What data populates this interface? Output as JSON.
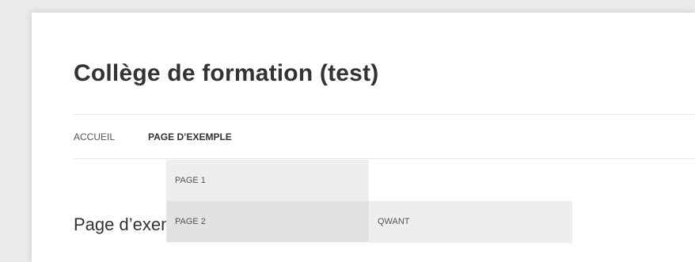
{
  "site": {
    "title": "Collège de formation (test)"
  },
  "nav": {
    "items": [
      {
        "label": "ACCUEIL"
      },
      {
        "label": "PAGE D’EXEMPLE"
      }
    ]
  },
  "dropdown": {
    "items": [
      {
        "label": "PAGE 1"
      },
      {
        "label": "PAGE 2"
      }
    ],
    "submenu": {
      "items": [
        {
          "label": "QWANT"
        }
      ]
    }
  },
  "content": {
    "heading": "Page d’exemple"
  }
}
